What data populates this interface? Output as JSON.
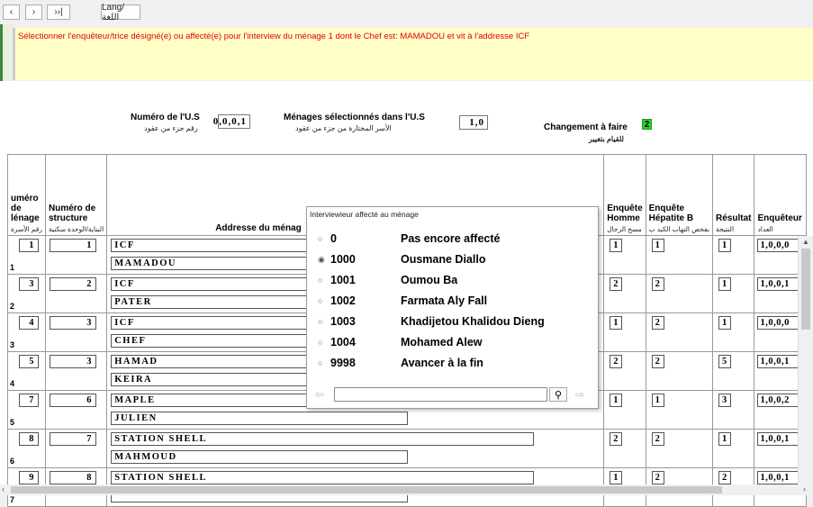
{
  "toolbar": {
    "first": "‹",
    "prev": "›",
    "last": "››|",
    "lang": "Lang/اللغة"
  },
  "message": "Sélectionner l'enquêteur/trice désigné(e) ou affecté(e) pour l'interview du ménage 1  dont le Chef est: MAMADOU et vit à l'addresse ICF",
  "header": {
    "us_label": "Numéro de l'U.S",
    "us_label_ar": "رقم جزء من عقود",
    "us_value": "0,0,0,1",
    "menages_label": "Ménages sélectionnés dans l'U.S",
    "menages_label_ar": "الأسر المختارة من جزء من عقود",
    "menages_value": "1,0",
    "changement_label": "Changement à faire",
    "changement_label_ar": "للقيام بتغيير",
    "changement_value": "2"
  },
  "columns": {
    "menage": "uméro de lénage",
    "menage_ar": "رقم الأسرة",
    "structure": "Numéro de structure",
    "structure_ar": "البناية/الوحدة سكنية",
    "addresse": "Addresse du ménag",
    "homme": "Enquête Homme",
    "homme_ar": "مسح الرجال",
    "hepatite": "Enquête Hépatite B",
    "hepatite_ar": "بفحص التهاب الكبد ب",
    "resultat": "Résultat",
    "resultat_ar": "النتيجة",
    "enqueteur": "Enquêteur",
    "enqueteur_ar": "العداد"
  },
  "rows": [
    {
      "n": "1",
      "menage": "1",
      "structure": "1",
      "addr1": "ICF",
      "addr2": "MAMADOU",
      "homme": "1",
      "hep": "1",
      "res": "1",
      "enq": "1,0,0,0"
    },
    {
      "n": "2",
      "menage": "3",
      "structure": "2",
      "addr1": "ICF",
      "addr2": "PATER",
      "homme": "2",
      "hep": "2",
      "res": "1",
      "enq": "1,0,0,1"
    },
    {
      "n": "3",
      "menage": "4",
      "structure": "3",
      "addr1": "ICF",
      "addr2": "CHEF",
      "homme": "1",
      "hep": "2",
      "res": "1",
      "enq": "1,0,0,0"
    },
    {
      "n": "4",
      "menage": "5",
      "structure": "3",
      "addr1": "HAMAD",
      "addr2": "KEIRA",
      "homme": "2",
      "hep": "2",
      "res": "5",
      "enq": "1,0,0,1"
    },
    {
      "n": "5",
      "menage": "7",
      "structure": "6",
      "addr1": "MAPLE",
      "addr2": "JULIEN",
      "homme": "1",
      "hep": "1",
      "res": "3",
      "enq": "1,0,0,2"
    },
    {
      "n": "6",
      "menage": "8",
      "structure": "7",
      "addr1": "STATION SHELL",
      "addr2": "MAHMOUD",
      "homme": "2",
      "hep": "2",
      "res": "1",
      "enq": "1,0,0,1"
    },
    {
      "n": "7",
      "menage": "9",
      "structure": "8",
      "addr1": "STATION SHELL",
      "addr2": "",
      "homme": "1",
      "hep": "2",
      "res": "2",
      "enq": "1,0,0,1"
    }
  ],
  "popup": {
    "title": "Interviewieur affecté au ménage",
    "selected": "1000",
    "options": [
      {
        "code": "0",
        "name": "Pas encore affecté"
      },
      {
        "code": "1000",
        "name": "Ousmane Diallo"
      },
      {
        "code": "1001",
        "name": "Oumou Ba"
      },
      {
        "code": "1002",
        "name": "Farmata Aly Fall"
      },
      {
        "code": "1003",
        "name": "Khadijetou Khalidou Dieng"
      },
      {
        "code": "1004",
        "name": "Mohamed Alew"
      },
      {
        "code": "9998",
        "name": "Avancer à la fin"
      }
    ],
    "search_value": ""
  }
}
